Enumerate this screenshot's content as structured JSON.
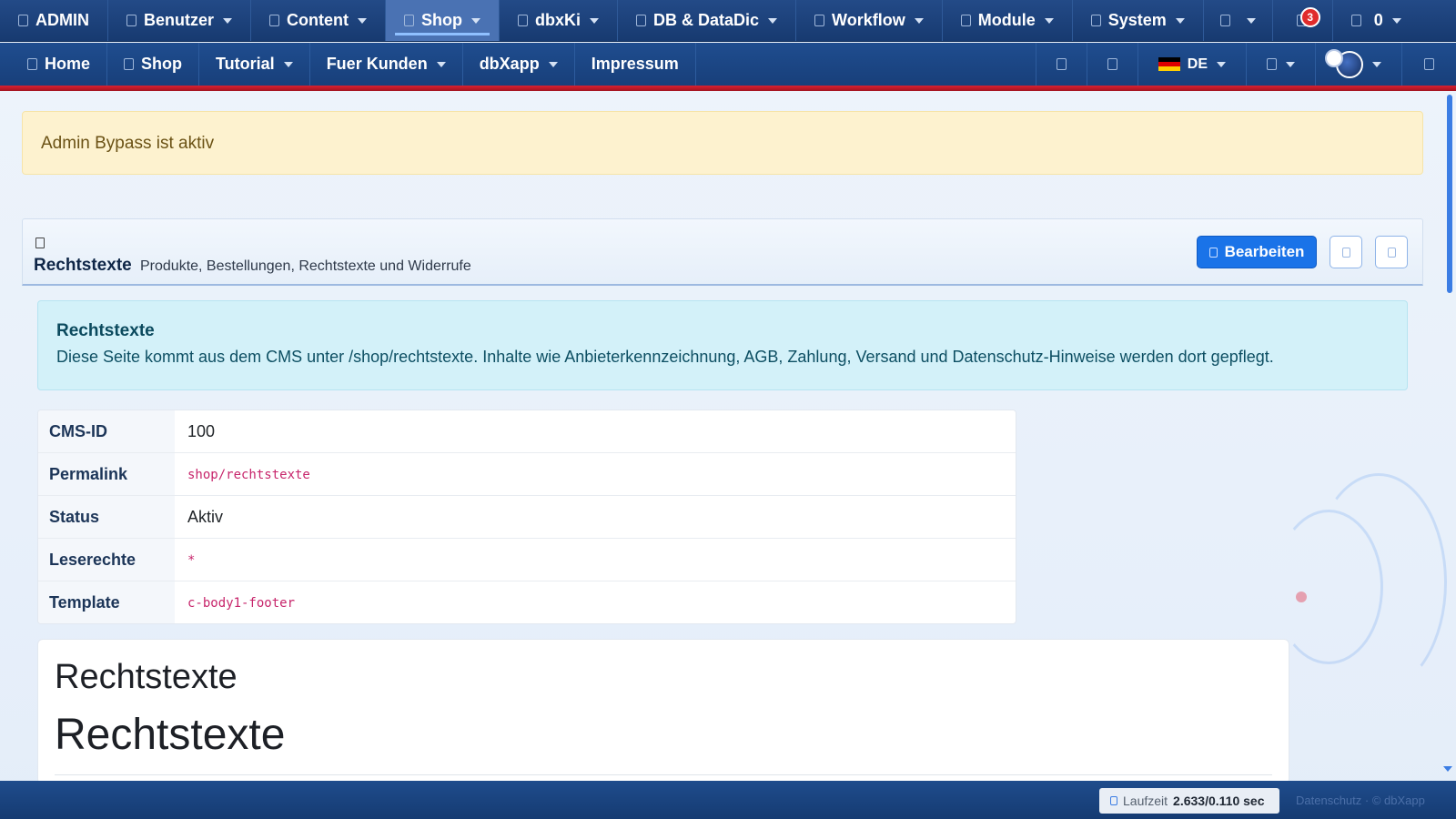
{
  "adminbar": {
    "items": [
      {
        "label": "ADMIN",
        "dropdown": false
      },
      {
        "label": "Benutzer",
        "dropdown": true
      },
      {
        "label": "Content",
        "dropdown": true
      },
      {
        "label": "Shop",
        "dropdown": true,
        "active": true
      },
      {
        "label": "dbxKi",
        "dropdown": true
      },
      {
        "label": "DB & DataDic",
        "dropdown": true
      },
      {
        "label": "Workflow",
        "dropdown": true
      },
      {
        "label": "Module",
        "dropdown": true
      },
      {
        "label": "System",
        "dropdown": true
      }
    ],
    "notifications_count": "3",
    "cart_count": "0"
  },
  "mainnav": {
    "items": [
      {
        "label": "Home",
        "dropdown": false
      },
      {
        "label": "Shop",
        "dropdown": false
      },
      {
        "label": "Tutorial",
        "dropdown": true
      },
      {
        "label": "Fuer Kunden",
        "dropdown": true
      },
      {
        "label": "dbXapp",
        "dropdown": true
      },
      {
        "label": "Impressum",
        "dropdown": false
      }
    ],
    "language": "DE",
    "flag_colors": [
      "#000000",
      "#dd0000",
      "#ffce00"
    ]
  },
  "alert": {
    "text": "Admin Bypass ist aktiv"
  },
  "card_header": {
    "title": "Rechtstexte",
    "subtitle": "Produkte, Bestellungen, Rechtstexte und Widerrufe",
    "edit_label": "Bearbeiten"
  },
  "info": {
    "title": "Rechtstexte",
    "text": "Diese Seite kommt aus dem CMS unter /shop/rechtstexte. Inhalte wie Anbieterkennzeichnung, AGB, Zahlung, Versand und Datenschutz-Hinweise werden dort gepflegt."
  },
  "meta": {
    "rows": [
      {
        "key": "CMS-ID",
        "value": "100",
        "code": false
      },
      {
        "key": "Permalink",
        "value": "shop/rechtstexte",
        "code": true
      },
      {
        "key": "Status",
        "value": "Aktiv",
        "code": false
      },
      {
        "key": "Leserechte",
        "value": "*",
        "code": true
      },
      {
        "key": "Template",
        "value": "c-body1-footer",
        "code": true
      }
    ]
  },
  "content": {
    "h2": "Rechtstexte",
    "h1": "Rechtstexte"
  },
  "footer": {
    "runtime_label": "Laufzeit",
    "runtime_value": "2.633/0.110 sec",
    "links": "Datenschutz · © dbXapp"
  },
  "colors": {
    "navbar": "#1f4d8f",
    "accent_red": "#d92030",
    "primary_button": "#1a73e8",
    "alert_warning": "#fdf2cf",
    "alert_info": "#d3f1f9"
  }
}
